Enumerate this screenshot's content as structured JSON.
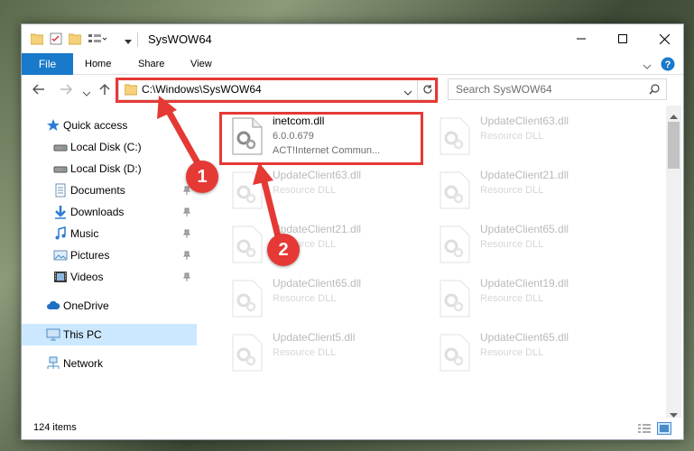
{
  "window": {
    "title": "SysWOW64"
  },
  "ribbon": {
    "tabs": [
      {
        "label": "File"
      },
      {
        "label": "Home"
      },
      {
        "label": "Share"
      },
      {
        "label": "View"
      }
    ]
  },
  "address": {
    "path": "C:\\Windows\\SysWOW64"
  },
  "search": {
    "placeholder": "Search SysWOW64"
  },
  "sidebar": {
    "items": [
      {
        "label": "Quick access",
        "icon": "star-icon"
      },
      {
        "label": "Local Disk (C:)",
        "icon": "drive-icon"
      },
      {
        "label": "Local Disk (D:)",
        "icon": "drive-icon"
      },
      {
        "label": "Documents",
        "icon": "documents-icon"
      },
      {
        "label": "Downloads",
        "icon": "download-icon"
      },
      {
        "label": "Music",
        "icon": "music-icon"
      },
      {
        "label": "Pictures",
        "icon": "pictures-icon"
      },
      {
        "label": "Videos",
        "icon": "videos-icon"
      },
      {
        "label": "OneDrive",
        "icon": "cloud-icon"
      },
      {
        "label": "This PC",
        "icon": "computer-icon"
      },
      {
        "label": "Network",
        "icon": "network-icon"
      }
    ]
  },
  "files": [
    {
      "name": "inetcom.dll",
      "version": "6.0.0.679",
      "desc": "ACT!Internet Commun..."
    },
    {
      "name": "UpdateClient63.dll",
      "desc": "Resource DLL"
    },
    {
      "name": "UpdateClient63.dll",
      "desc": "Resource DLL"
    },
    {
      "name": "UpdateClient21.dll",
      "desc": "Resource DLL"
    },
    {
      "name": "UpdateClient21.dll",
      "desc": "Resource DLL"
    },
    {
      "name": "UpdateClient65.dll",
      "desc": "Resource DLL"
    },
    {
      "name": "UpdateClient65.dll",
      "desc": "Resource DLL"
    },
    {
      "name": "UpdateClient19.dll",
      "desc": "Resource DLL"
    },
    {
      "name": "UpdateClient5.dll",
      "desc": "Resource DLL"
    },
    {
      "name": "UpdateClient65.dll",
      "desc": "Resource DLL"
    }
  ],
  "status": {
    "item_count": "124 items"
  },
  "annotations": {
    "callout_1": "1",
    "callout_2": "2",
    "color": "#e53935"
  },
  "colors": {
    "file_tab": "#1979ca",
    "selected": "#cce8ff"
  }
}
